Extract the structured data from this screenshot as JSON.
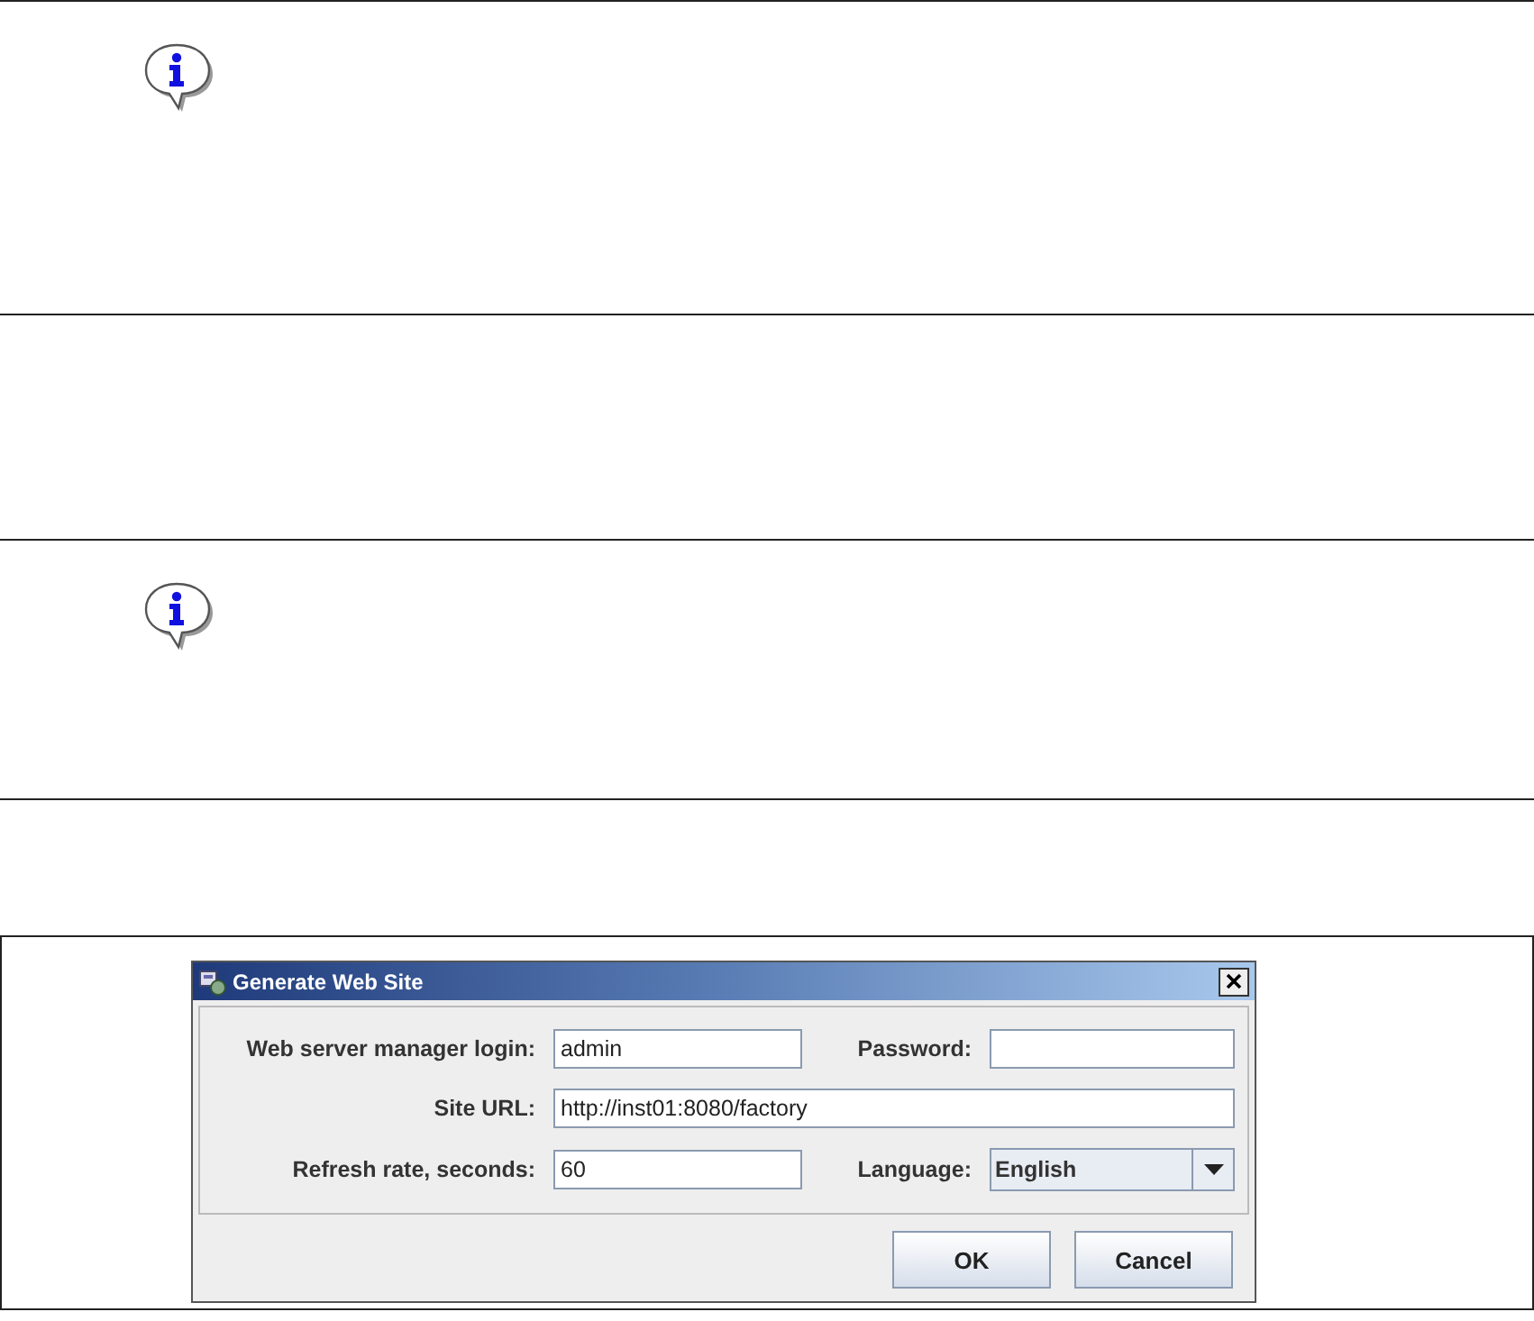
{
  "sections": [
    {
      "kind": "info"
    },
    {
      "kind": "blank"
    },
    {
      "kind": "info"
    }
  ],
  "dialog": {
    "title": "Generate Web Site",
    "fields": [
      {
        "label": "Web server manager login:",
        "value": "admin"
      },
      {
        "label": "Password:"
      },
      {
        "label": "Site URL:",
        "value": "http://inst01:8080/factory"
      },
      {
        "label": "Refresh rate, seconds:",
        "value": "60"
      }
    ],
    "language": {
      "label": "Language:",
      "value": "English"
    },
    "buttons": [
      "OK",
      "Cancel"
    ]
  }
}
